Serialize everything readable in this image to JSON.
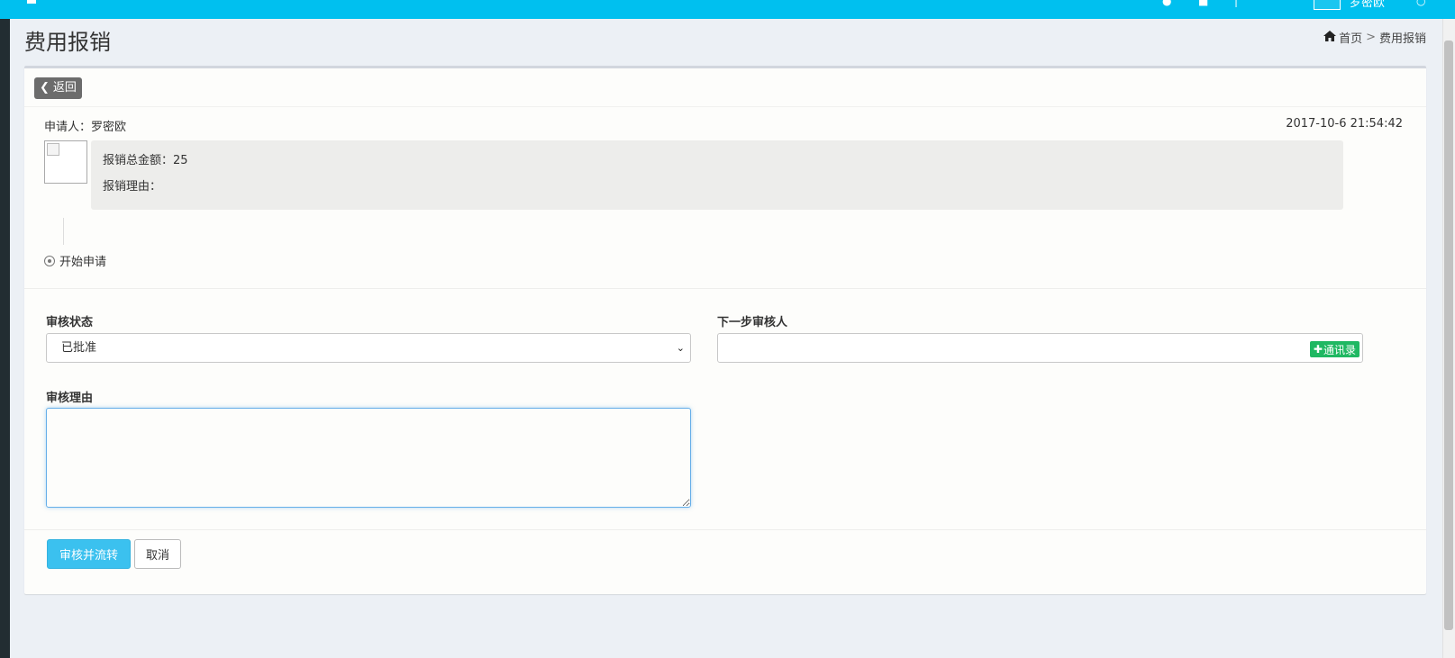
{
  "header": {
    "user_name": "罗密欧",
    "bg_color": "#00c0ef"
  },
  "page": {
    "title": "费用报销"
  },
  "breadcrumb": {
    "home": "首页",
    "separator": ">",
    "current": "费用报销"
  },
  "box": {
    "back_label": "返回"
  },
  "application": {
    "applicant_label": "申请人：",
    "applicant_name": "罗密欧",
    "timestamp": "2017-10-6 21:54:42",
    "total_label": "报销总金额：",
    "total_value": "25",
    "reason_label": "报销理由："
  },
  "timeline": {
    "start_label": "开始申请"
  },
  "form": {
    "status_label": "审核状态",
    "status_selected": "已批准",
    "next_reviewer_label": "下一步审核人",
    "next_reviewer_value": "",
    "contacts_label": "通讯录",
    "reason_label": "审核理由",
    "reason_value": ""
  },
  "actions": {
    "submit_label": "审核并流转",
    "cancel_label": "取消"
  },
  "colors": {
    "accent": "#3bc1ef",
    "contacts_green": "#1fb862",
    "sidebar_dark": "#222d32"
  }
}
